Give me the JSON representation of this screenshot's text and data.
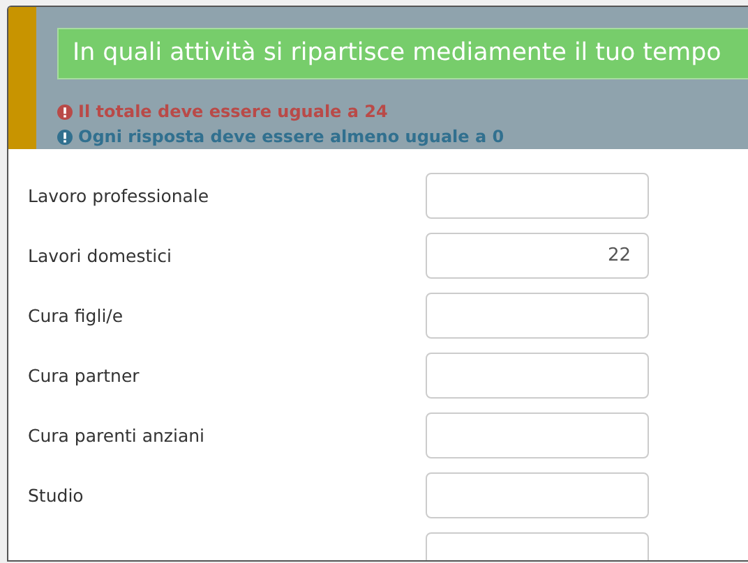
{
  "question": {
    "title": "In quali attività si ripartisce mediamente il tuo tempo",
    "messages": [
      {
        "kind": "error",
        "text": "Il totale deve essere uguale a 24"
      },
      {
        "kind": "info",
        "text": "Ogni risposta deve essere almeno uguale a 0"
      }
    ]
  },
  "rows": [
    {
      "label": "Lavoro professionale"
    },
    {
      "label": "Lavori domestici",
      "value": "22"
    },
    {
      "label": "Cura figli/e"
    },
    {
      "label": "Cura partner"
    },
    {
      "label": "Cura parenti anziani"
    },
    {
      "label": "Studio"
    },
    {}
  ]
}
